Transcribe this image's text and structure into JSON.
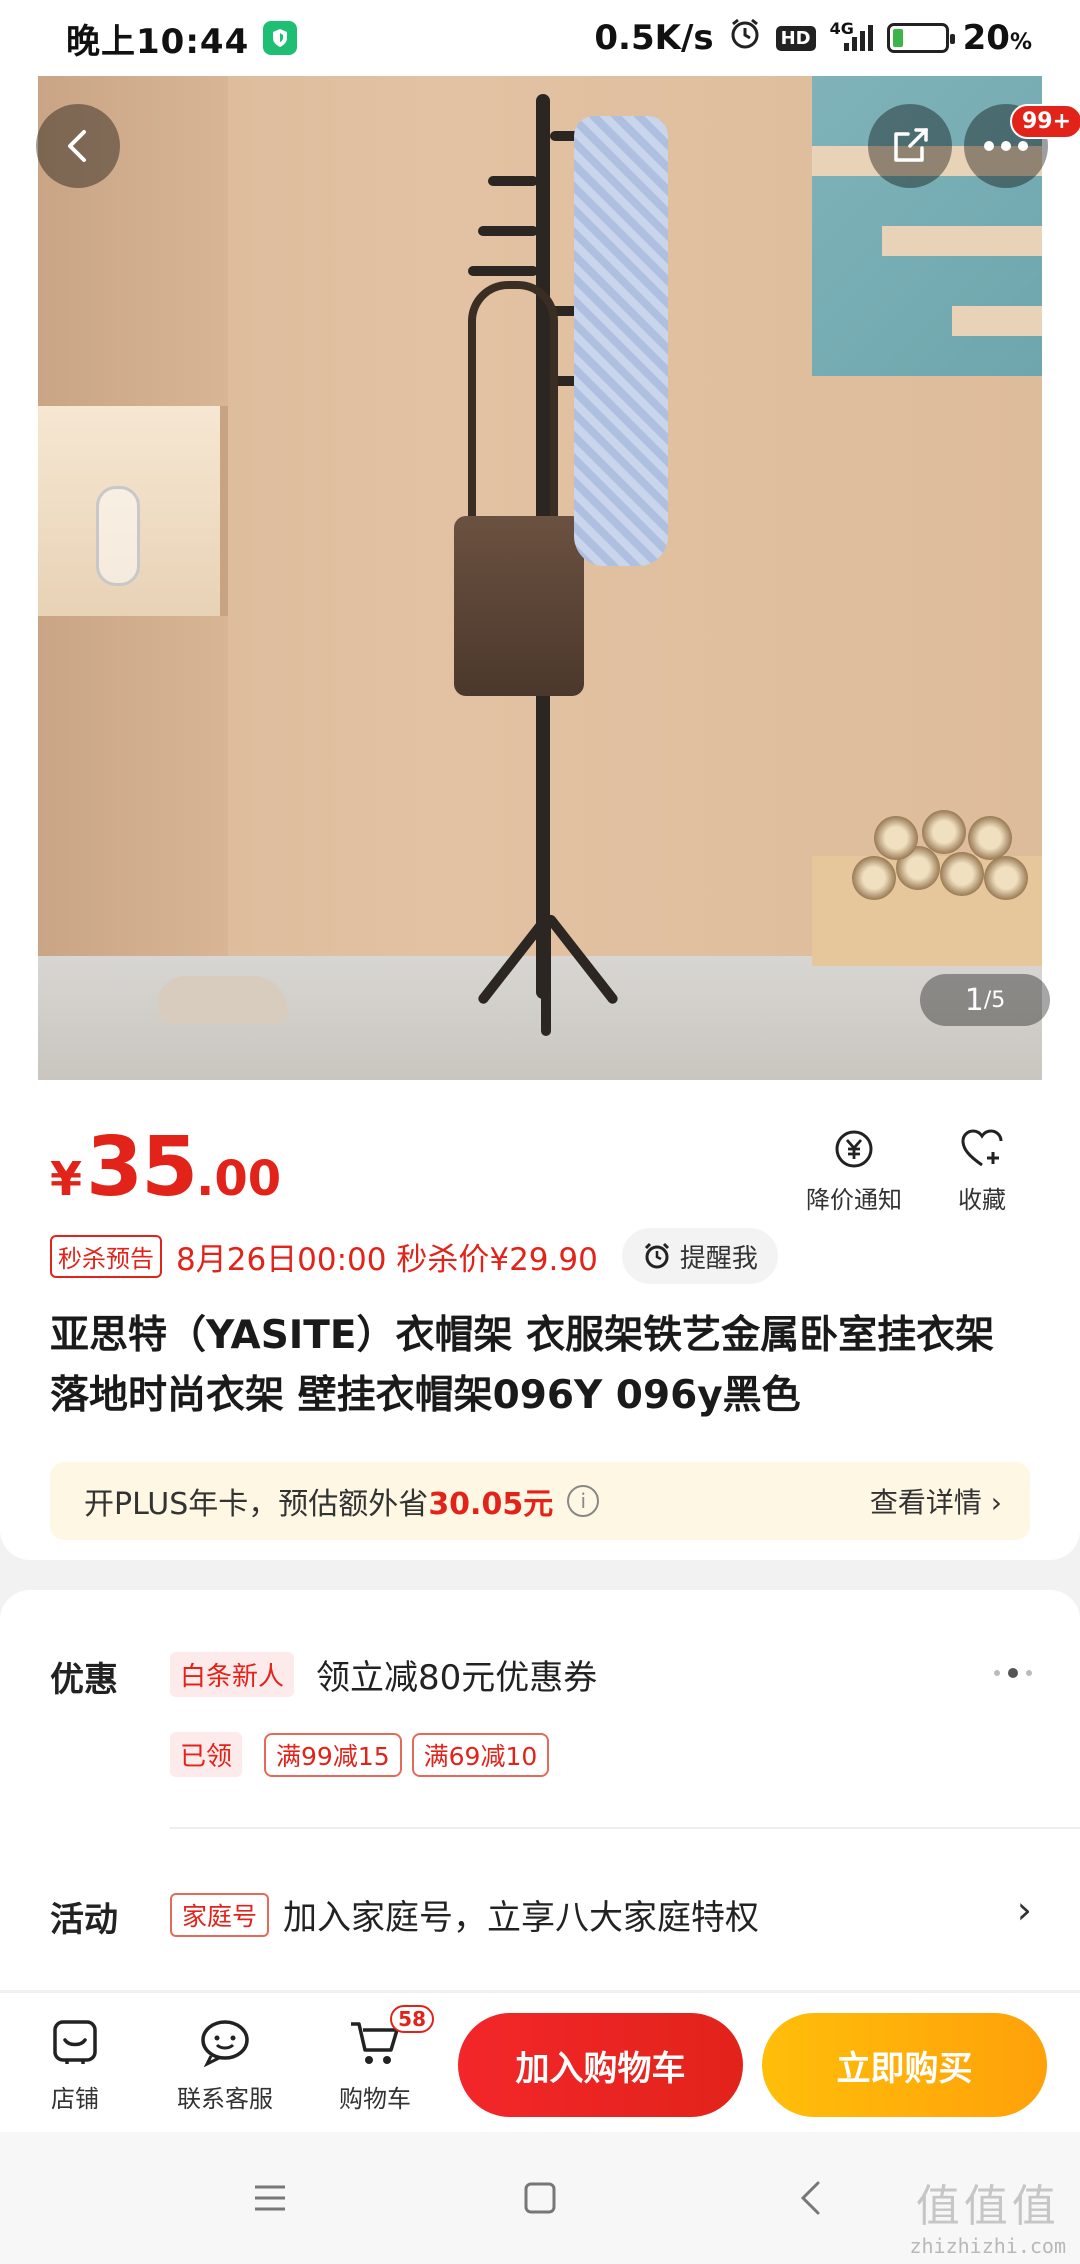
{
  "status_bar": {
    "time": "晚上10:44",
    "speed": "0.5K/s",
    "hd": "HD",
    "network": "4G",
    "battery": "20",
    "battery_unit": "%",
    "battery_level": 0.2
  },
  "hero": {
    "more_badge": "99+",
    "pager_current": "1",
    "pager_total": "/5"
  },
  "price": {
    "currency": "¥",
    "integer": "35",
    "decimal": ".00",
    "price_alert_label": "降价通知",
    "favorite_label": "收藏"
  },
  "flash_sale": {
    "tag": "秒杀预告",
    "text": "8月26日00:00 秒杀价¥29.90",
    "remind_label": "提醒我"
  },
  "product_title": "亚思特（YASITE）衣帽架 衣服架铁艺金属卧室挂衣架 落地时尚衣架 壁挂衣帽架096Y 096y黑色",
  "plus": {
    "prefix": "开PLUS年卡，预估额外省",
    "amount": "30.05元",
    "info_icon": "i",
    "details": "查看详情 ›"
  },
  "promotions": {
    "discount_label": "优惠",
    "baitiao_chip": "白条新人",
    "baitiao_desc": "领立减80元优惠券",
    "claimed_chip": "已领",
    "coupons": [
      "满99减15",
      "满69减10"
    ],
    "activity_label": "活动",
    "family_chip": "家庭号",
    "family_desc": "加入家庭号，立享八大家庭特权",
    "chevron": "›"
  },
  "action_bar": {
    "store_label": "店铺",
    "service_label": "联系客服",
    "cart_label": "购物车",
    "cart_count": "58",
    "add_to_cart": "加入购物车",
    "buy_now": "立即购买"
  },
  "watermark": {
    "big": "值值值",
    "small": "zhizhizhi.com"
  },
  "colors": {
    "accent_red": "#e2231a",
    "buy_orange": "#ffa10a"
  }
}
